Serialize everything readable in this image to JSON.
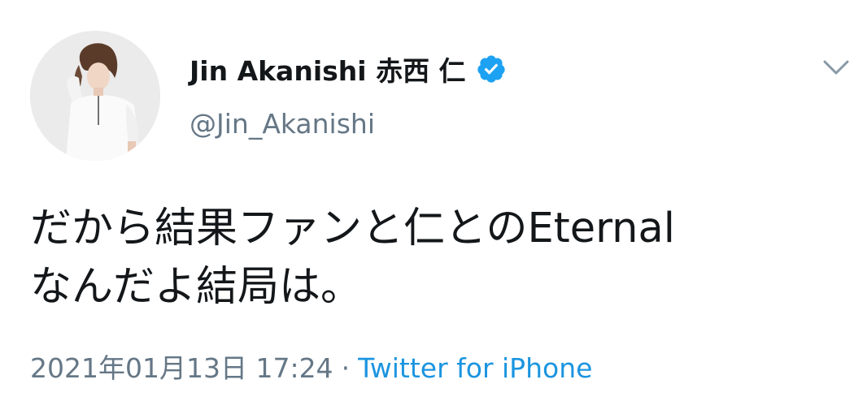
{
  "tweet": {
    "author": {
      "display_name": "Jin Akanishi  赤西 仁",
      "handle": "@Jin_Akanishi",
      "verified": true
    },
    "text_lines": [
      "だから結果ファンと仁とのEternal",
      "なんだよ結局は。"
    ],
    "timestamp": "2021年01月13日 17:24",
    "separator": "·",
    "source": "Twitter for iPhone",
    "menu_icon": "chevron-down-icon",
    "colors": {
      "accent": "#1b95e0",
      "verified_badge": "#1da1f2",
      "secondary_text": "#657786",
      "primary_text": "#14171a"
    }
  }
}
